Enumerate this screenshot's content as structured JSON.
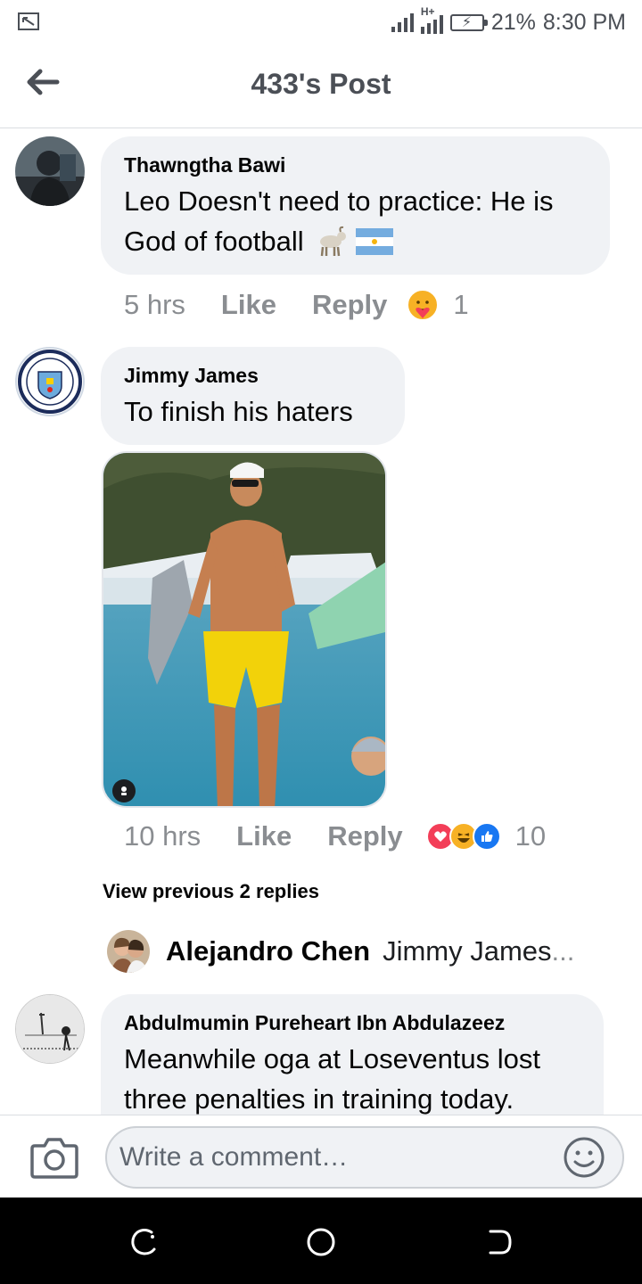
{
  "status_bar": {
    "network": "H+",
    "battery": "21%",
    "time": "8:30 PM"
  },
  "header": {
    "title": "433's Post",
    "back_icon": "arrow-left-icon"
  },
  "comments": [
    {
      "author": "Thawngtha Bawi",
      "text": "Leo Doesn't need to practice: He is God of football 🐐🇦🇷",
      "line1": "Leo Doesn't need to practice: He is",
      "line2": "God of football",
      "time": "5 hrs",
      "like_label": "Like",
      "reply_label": "Reply",
      "reactions": [
        "care"
      ],
      "reaction_count": "1"
    },
    {
      "author": "Jimmy James",
      "text": "To finish his haters",
      "time": "10 hrs",
      "like_label": "Like",
      "reply_label": "Reply",
      "reactions": [
        "love",
        "haha",
        "like"
      ],
      "reaction_count": "10",
      "has_photo": true,
      "view_previous": "View previous 2 replies",
      "latest_reply": {
        "author": "Alejandro Chen",
        "snippet": "Jimmy James",
        "ellipsis": "..."
      }
    },
    {
      "author": "Abdulmumin Pureheart Ibn Abdulazeez",
      "line1": "Meanwhile oga at Loseventus lost",
      "line2": "three penalties in training today."
    }
  ],
  "composer": {
    "placeholder": "Write a comment…",
    "camera_icon": "camera-icon",
    "emoji_icon": "smiley-icon"
  },
  "colors": {
    "bubble": "#f0f2f5",
    "meta_gray": "#8a8d91",
    "love": "#f33e58",
    "haha": "#f7b125",
    "like": "#1877f2"
  }
}
